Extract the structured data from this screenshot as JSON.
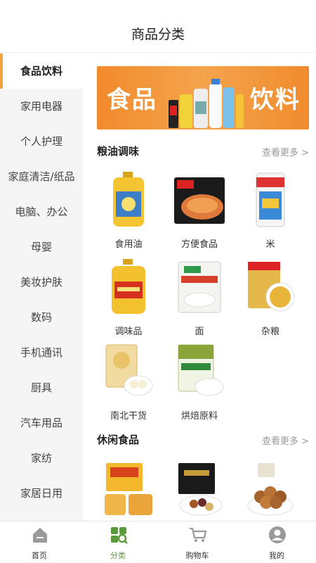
{
  "header": {
    "title": "商品分类"
  },
  "sidebar": {
    "items": [
      {
        "label": "食品饮料"
      },
      {
        "label": "家用电器"
      },
      {
        "label": "个人护理"
      },
      {
        "label": "家庭清洁/纸品"
      },
      {
        "label": "电脑、办公"
      },
      {
        "label": "母婴"
      },
      {
        "label": "美妆护肤"
      },
      {
        "label": "数码"
      },
      {
        "label": "手机通讯"
      },
      {
        "label": "厨具"
      },
      {
        "label": "汽车用品"
      },
      {
        "label": "家纺"
      },
      {
        "label": "家居日用"
      }
    ]
  },
  "banner": {
    "left_text": "食品",
    "right_text": "饮料"
  },
  "sections": [
    {
      "title": "粮油调味",
      "more": "查看更多 >",
      "items": [
        {
          "label": "食用油",
          "icon": "oil-bottle-icon"
        },
        {
          "label": "方便食品",
          "icon": "instant-noodle-icon"
        },
        {
          "label": "米",
          "icon": "rice-bag-icon"
        },
        {
          "label": "调味品",
          "icon": "seasoning-bottle-icon"
        },
        {
          "label": "面",
          "icon": "flour-bag-icon"
        },
        {
          "label": "杂粮",
          "icon": "grain-bag-icon"
        },
        {
          "label": "南北干货",
          "icon": "dried-goods-icon"
        },
        {
          "label": "烘焙原料",
          "icon": "baking-starch-icon"
        }
      ]
    },
    {
      "title": "休闲食品",
      "more": "查看更多 >",
      "items": [
        {
          "label": "",
          "icon": "cake-box-icon"
        },
        {
          "label": "",
          "icon": "nut-gift-box-icon"
        },
        {
          "label": "",
          "icon": "macadamia-nuts-icon"
        }
      ]
    }
  ],
  "tabbar": {
    "items": [
      {
        "label": "首页",
        "icon": "home-icon"
      },
      {
        "label": "分类",
        "icon": "category-icon"
      },
      {
        "label": "购物车",
        "icon": "cart-icon"
      },
      {
        "label": "我的",
        "icon": "user-icon"
      }
    ]
  },
  "colors": {
    "accent": "#f2a23c",
    "tab_active": "#5a9a3a",
    "banner": "#f28a2c"
  }
}
